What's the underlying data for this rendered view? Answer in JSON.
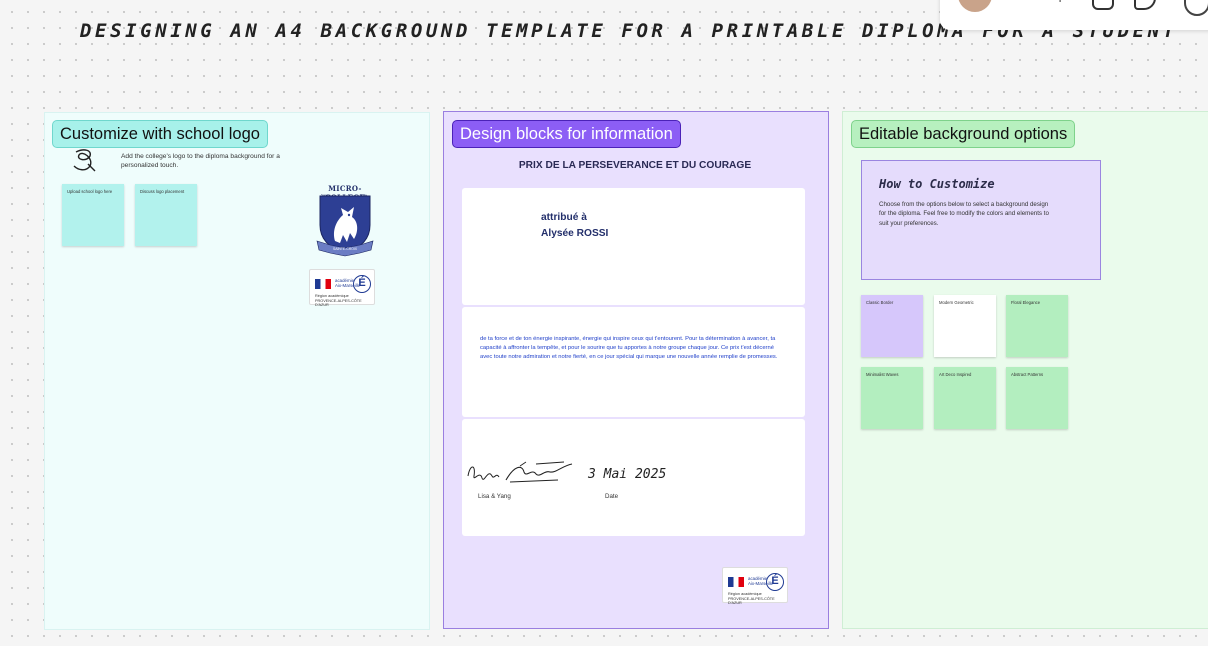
{
  "board": {
    "title": "DESIGNING AN A4 BACKGROUND TEMPLATE FOR A PRINTABLE DIPLOMA FOR A STUDENT"
  },
  "colors": {
    "frame1_bg": "#effdfc",
    "frame1_title_bg": "#a7f1ea",
    "frame2_bg": "#e9e0fe",
    "frame2_title_bg": "#8c5ef5",
    "frame3_bg": "#eafbec",
    "frame3_title_bg": "#b7f0bf",
    "sticky_cyan": "#b2f2ed",
    "sticky_purple": "#d6c7fb",
    "sticky_white": "#ffffff",
    "sticky_green": "#b3eebf",
    "sentence_text": "#1f3fc9"
  },
  "frame1": {
    "title": "Customize with school logo",
    "description": "Add the college's logo to the diploma background for a personalized touch.",
    "icon": "pen-sketch-icon",
    "stickies": [
      "Upload school logo here",
      "Discuss logo placement"
    ],
    "crest": {
      "name": "MICRO-COLLEGE",
      "motto_left": "Sapere",
      "motto_right": "Aude",
      "banner": "SAINTE-CROIX"
    },
    "ministry_logo": {
      "line1": "académie",
      "line2": "Aix-Marseille",
      "line3": "Région académique",
      "line4": "PROVENCE-ALPES-CÔTE D'AZUR",
      "mark": "É"
    }
  },
  "frame2": {
    "title": "Design blocks for information",
    "diploma_title": "PRIX DE LA PERSEVERANCE ET DU COURAGE",
    "attributed": "attribué à",
    "recipient": "Alysée ROSSI",
    "sentence": "de ta force et de ton énergie inspirante, énergie qui inspire ceux qui t'entourent. Pour ta détermination à avancer, ta capacité à affronter la tempête, et pour le sourire que tu apportes à notre groupe chaque jour. Ce prix t'est décerné avec toute notre admiration et notre fierté, en ce jour spécial qui marque une nouvelle année remplie de promesses.",
    "date": "3 Mai 2025",
    "signers_label": "Lisa & Yang",
    "date_label": "Date",
    "ministry_logo": {
      "line1": "académie",
      "line2": "Aix-Marseille",
      "line3": "Région académique",
      "line4": "PROVENCE-ALPES-CÔTE D'AZUR",
      "mark": "É"
    }
  },
  "frame3": {
    "title": "Editable background options",
    "howto_title": "How to Customize",
    "howto_text": "Choose from the options below to select a background design for the diploma. Feel free to modify the colors and elements to suit your preferences.",
    "options": [
      "Classic Border",
      "Modern Geometric",
      "Floral Elegance",
      "Minimalist Waves",
      "Art Deco Inspired",
      "Abstract Patterns"
    ]
  },
  "toolbar": {
    "icons": [
      "user-avatar-icon",
      "ai-sparkle-icon",
      "template-icon",
      "reaction-icon",
      "more-icon"
    ]
  }
}
